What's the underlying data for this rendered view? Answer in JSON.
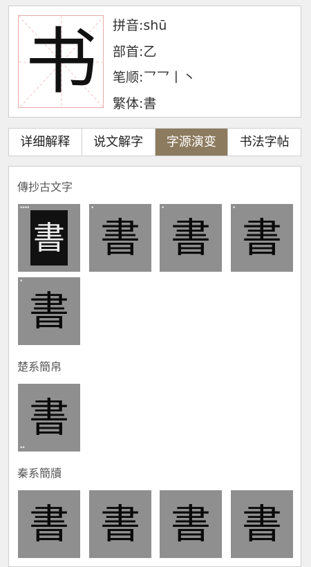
{
  "character": {
    "glyph": "书",
    "pinyin_label": "拼音:shū",
    "radical_label": "部首:乙",
    "strokes_label": "笔顺:乛乛丨丶",
    "traditional_label": "繁体:書"
  },
  "tabs": [
    {
      "label": "详细解释",
      "active": false
    },
    {
      "label": "说文解字",
      "active": false
    },
    {
      "label": "字源演变",
      "active": true
    },
    {
      "label": "书法字帖",
      "active": false
    }
  ],
  "colors": {
    "active_tab": "#8c7b5f",
    "tile_gray": "#8f8f8f",
    "grid_red": "#e8a9a9"
  },
  "sections": [
    {
      "title": "傳抄古文字",
      "glyphs": [
        "書",
        "書",
        "書",
        "書",
        "書"
      ]
    },
    {
      "title": "楚系簡帛",
      "glyphs": [
        "書"
      ]
    },
    {
      "title": "秦系簡牘",
      "glyphs": [
        "書",
        "書",
        "書",
        "書"
      ]
    }
  ]
}
